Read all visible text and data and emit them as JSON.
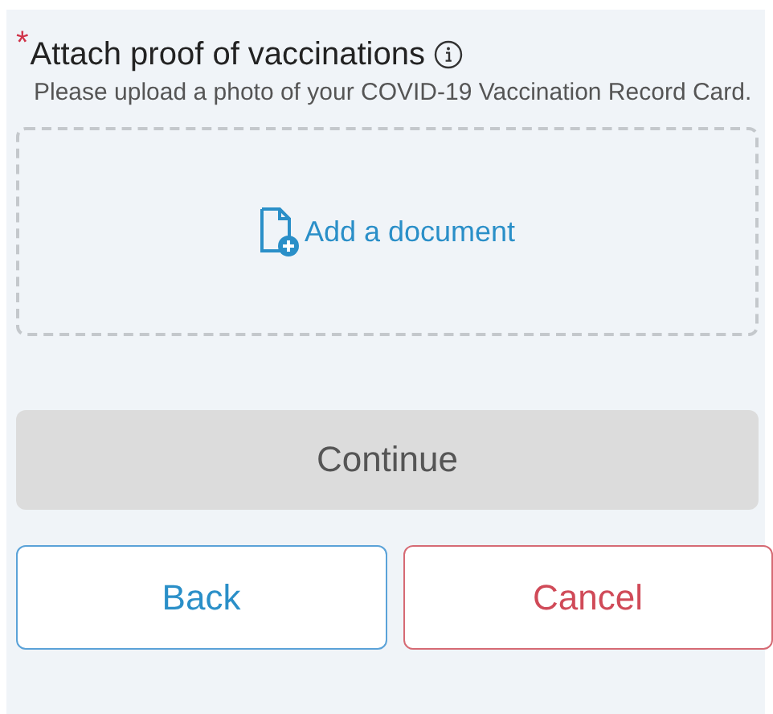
{
  "field": {
    "required": true,
    "required_mark": "*",
    "label": "Attach proof of vaccinations",
    "help": "Please upload a photo of your COVID-19 Vaccination Record Card.",
    "upload": {
      "label": "Add a document"
    }
  },
  "continue_button": {
    "label": "Continue",
    "disabled": true
  },
  "buttons": [
    {
      "label": "Back",
      "kind": "primary"
    },
    {
      "label": "Cancel",
      "kind": "danger"
    }
  ]
}
